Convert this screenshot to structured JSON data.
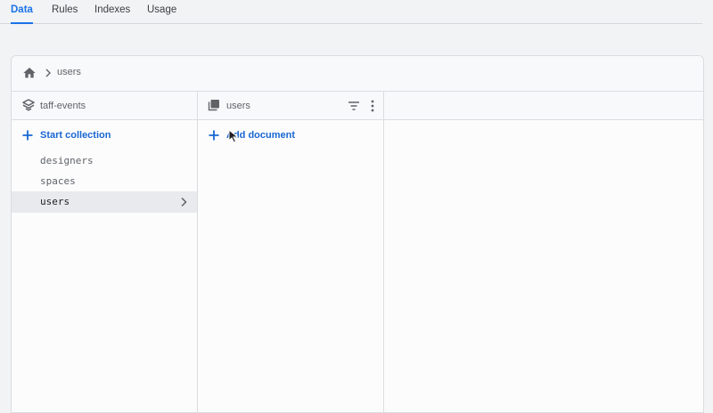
{
  "tabs": [
    {
      "label": "Data",
      "active": true
    },
    {
      "label": "Rules",
      "active": false
    },
    {
      "label": "Indexes",
      "active": false
    },
    {
      "label": "Usage",
      "active": false
    }
  ],
  "breadcrumb": {
    "home_icon": "home-icon",
    "path": "users"
  },
  "root_column": {
    "title": "taff-events",
    "icon": "firestore-icon",
    "action_label": "Start collection",
    "collections": [
      {
        "name": "designers",
        "selected": false
      },
      {
        "name": "spaces",
        "selected": false
      },
      {
        "name": "users",
        "selected": true
      }
    ]
  },
  "collection_column": {
    "title": "users",
    "icon": "collection-icon",
    "action_label": "Add document"
  },
  "colors": {
    "accent": "#1a73e8",
    "link": "#1967d2",
    "selected_row": "#e8eaed"
  }
}
